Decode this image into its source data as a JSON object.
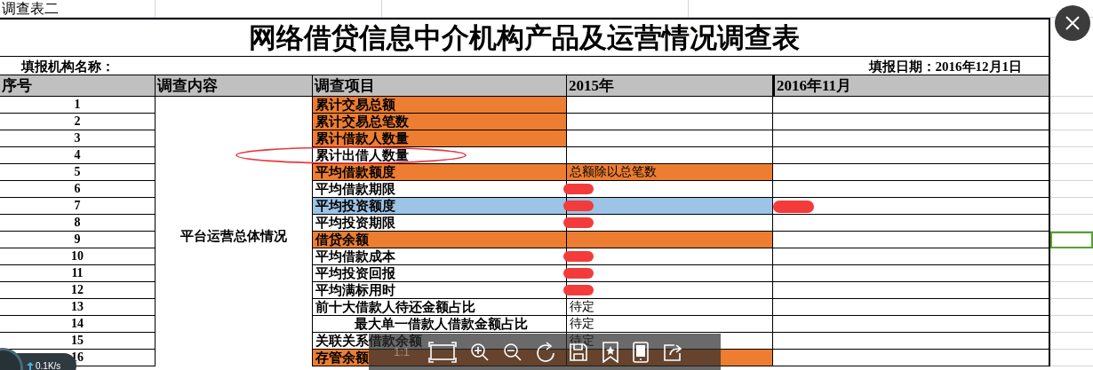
{
  "sheet_label": "调查表二",
  "title": "网络借贷信息中介机构产品及运营情况调查表",
  "org_label": "填报机构名称：",
  "date_label": "填报日期：2016年12月1日",
  "columns": [
    "序号",
    "调查内容",
    "调查项目",
    "2015年",
    "2016年11月"
  ],
  "section": "平台运营总体情况",
  "rows": [
    {
      "kind": "plain",
      "no": "1",
      "item": {
        "text": "累计交易总额",
        "color": "#ed7d31"
      }
    },
    {
      "kind": "plain",
      "no": "2",
      "item": {
        "text": "累计交易总笔数",
        "color": "#ed7d31"
      }
    },
    {
      "kind": "plain",
      "no": "3",
      "item": {
        "text": "累计借款人数量",
        "color": "#ed7d31"
      }
    },
    {
      "kind": "plain",
      "no": "4",
      "item": {
        "text": "累计出借人数量"
      },
      "circled": true
    },
    {
      "kind": "plain",
      "no": "5",
      "item": {
        "text": "平均借款额度",
        "color": "#ed7d31"
      },
      "y2015": {
        "text": "总额除以总笔数",
        "color": "#ed7d31"
      }
    },
    {
      "kind": "plain",
      "no": "6",
      "item": {
        "text": "平均借款期限"
      },
      "y2015": {
        "redacted": true
      }
    },
    {
      "kind": "plain",
      "no": "7",
      "item": {
        "text": "平均投资额度",
        "color": "#9dc3e6"
      },
      "y2015": {
        "color": "#9dc3e6",
        "redacted": true
      },
      "y2016": {
        "redacted": true
      }
    },
    {
      "kind": "plain",
      "no": "8",
      "item": {
        "text": "平均投资期限"
      },
      "y2015": {
        "redacted": true
      }
    },
    {
      "kind": "plain",
      "no": "9",
      "item": {
        "text": "借贷余额",
        "color": "#ed7d31"
      },
      "y2015": {
        "color": "#ed7d31"
      },
      "cell_selected": true
    },
    {
      "kind": "plain",
      "no": "10",
      "item": {
        "text": "平均借款成本"
      },
      "y2015": {
        "redacted": true
      }
    },
    {
      "kind": "plain",
      "no": "11",
      "item": {
        "text": "平均投资回报"
      },
      "y2015": {
        "redacted": true
      }
    },
    {
      "kind": "plain",
      "no": "12",
      "item": {
        "text": "平均满标用时"
      },
      "y2015": {
        "redacted": true
      }
    },
    {
      "kind": "plain",
      "no": "13",
      "item": {
        "text": "前十大借款人待还金额占比"
      },
      "y2015": {
        "text": "待定"
      }
    },
    {
      "kind": "centered",
      "no": "14",
      "item": {
        "text": "最大单一借款人借款金额占比"
      },
      "y2015": {
        "text": "待定"
      }
    },
    {
      "kind": "plain",
      "no": "15",
      "item": {
        "text": "关联关系借款余额"
      },
      "y2015": {
        "text": "待定"
      }
    },
    {
      "kind": "plain",
      "no": "16",
      "item": {
        "text": "存管余额",
        "color": "#ed7d31"
      },
      "y2015": {
        "color": "#ed7d31"
      }
    }
  ],
  "viewer_toolbar": {
    "ratio_label": "1:1"
  },
  "network_widget": {
    "speed": "0.1K/s"
  }
}
